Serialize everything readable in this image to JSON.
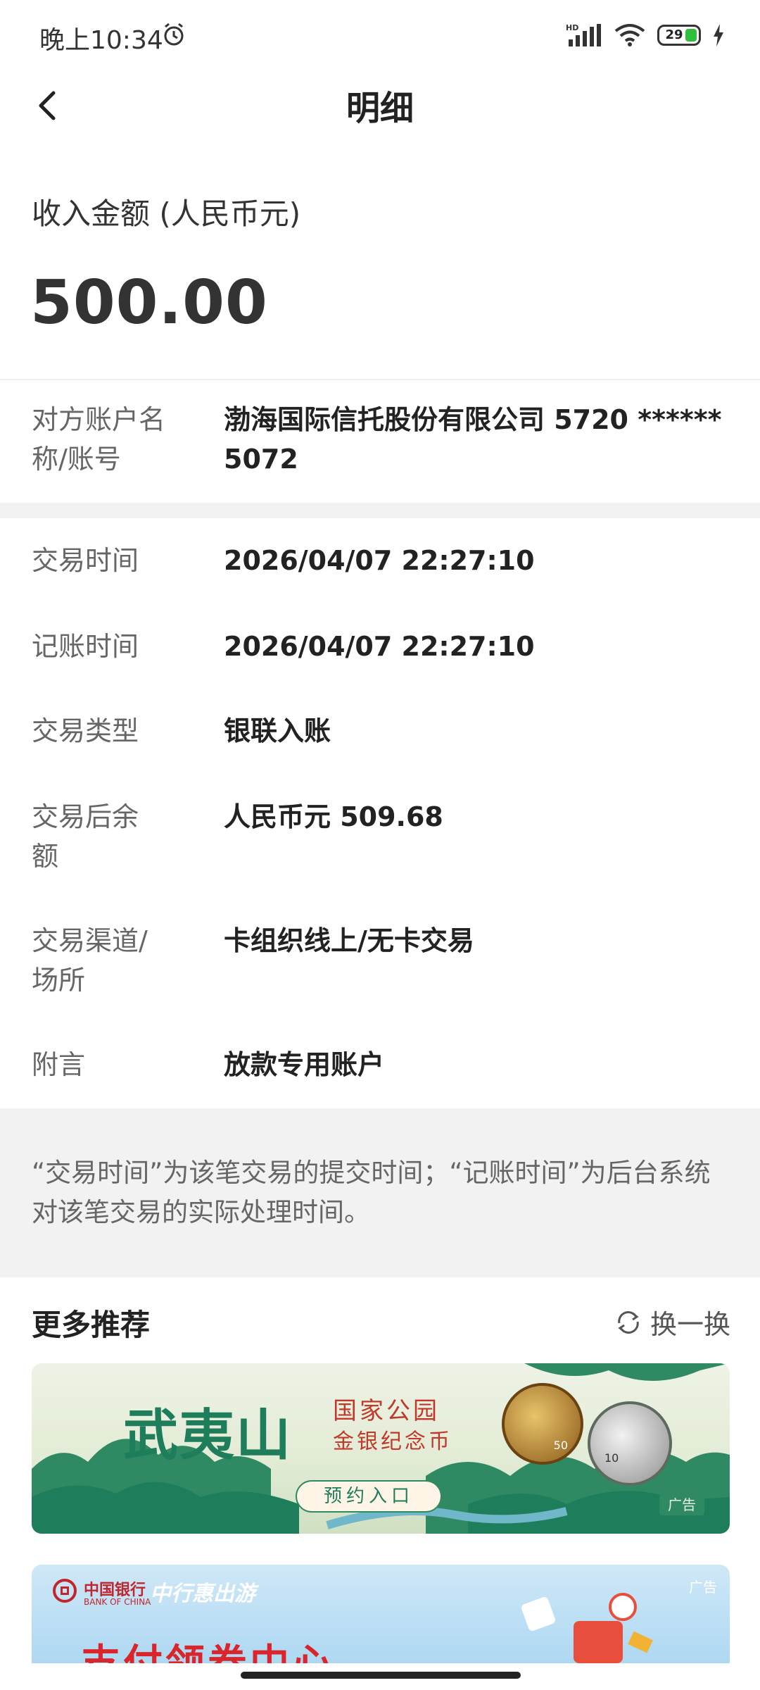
{
  "status_bar": {
    "time": "晚上10:34",
    "battery_level": "29",
    "signal": "HD"
  },
  "header": {
    "title": "明细"
  },
  "amount": {
    "label": "收入金额 (人民币元)",
    "value": "500.00"
  },
  "counterparty": {
    "label": "对方账户名称/账号",
    "value": "渤海国际信托股份有限公司 5720 ****** 5072"
  },
  "details": [
    {
      "label": "交易时间",
      "value": "2026/04/07 22:27:10"
    },
    {
      "label": "记账时间",
      "value": "2026/04/07 22:27:10"
    },
    {
      "label": "交易类型",
      "value": "银联入账"
    },
    {
      "label": "交易后余额",
      "value": "人民币元 509.68"
    },
    {
      "label": "交易渠道/场所",
      "value": "卡组织线上/无卡交易"
    },
    {
      "label": "附言",
      "value": "放款专用账户"
    }
  ],
  "note": "“交易时间”为该笔交易的提交时间；“记账时间”为后台系统对该笔交易的实际处理时间。",
  "recommendations": {
    "title": "更多推荐",
    "refresh_label": "换一换",
    "banner1": {
      "title": "武夷山",
      "subtitle_1": "国家公园",
      "subtitle_2": "金银纪念币",
      "cta": "预约入口",
      "coin_denomination": "50",
      "coin2_denomination": "10",
      "ad_label": "广告"
    },
    "banner2": {
      "bank_name": "中国银行",
      "bank_name_en": "BANK OF CHINA",
      "campaign": "中行惠出游",
      "headline": "支付领券中心",
      "ad_label": "广告"
    }
  },
  "colors": {
    "banner_green": "#1e7d5a",
    "banner_gold": "#b8862e",
    "banner_red": "#c0392b",
    "headline_red": "#d9262c"
  }
}
